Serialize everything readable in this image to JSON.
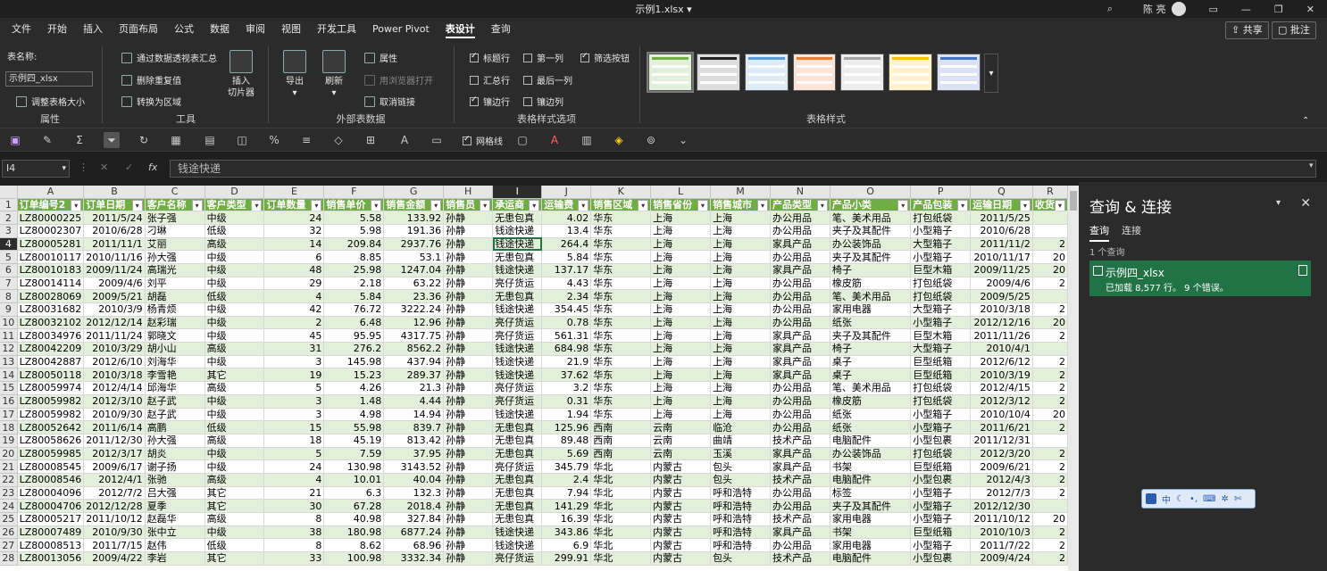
{
  "window": {
    "title": "示例1.xlsx",
    "user": "陈 亮"
  },
  "menu": {
    "tabs": [
      "文件",
      "开始",
      "插入",
      "页面布局",
      "公式",
      "数据",
      "审阅",
      "视图",
      "开发工具",
      "Power Pivot",
      "表设计",
      "查询"
    ],
    "active": "表设计",
    "share_label": "共享",
    "comment_label": "批注"
  },
  "ribbon": {
    "props": {
      "name_label": "表名称:",
      "name_value": "示例四_xlsx",
      "resize_label": "调整表格大小",
      "group": "属性"
    },
    "tools": {
      "pivot": "通过数据透视表汇总",
      "dedupe": "删除重复值",
      "convert": "转换为区域",
      "slicer": "插入\n切片器",
      "group": "工具"
    },
    "external": {
      "export": "导出",
      "refresh": "刷新",
      "properties": "属性",
      "open_browser": "用浏览器打开",
      "unlink": "取消链接",
      "group": "外部表数据"
    },
    "options": {
      "header_row": "标题行",
      "total_row": "汇总行",
      "banded_rows": "镶边行",
      "first_col": "第一列",
      "last_col": "最后一列",
      "banded_cols": "镶边列",
      "filter_btn": "筛选按钮",
      "group": "表格样式选项"
    },
    "styles": {
      "group": "表格样式"
    }
  },
  "qat": {
    "gridlines_label": "网格线"
  },
  "formula_bar": {
    "name_box": "I4",
    "fx": "fx",
    "content": "钱途快递"
  },
  "sheet": {
    "col_letters": [
      "A",
      "B",
      "C",
      "D",
      "E",
      "F",
      "G",
      "H",
      "I",
      "J",
      "K",
      "L",
      "M",
      "N",
      "O",
      "P",
      "Q",
      "R"
    ],
    "headers": [
      "订单编号2",
      "订单日期",
      "客户名称",
      "客户类型",
      "订单数量",
      "销售单价",
      "销售金额",
      "销售员",
      "承运商",
      "运输费",
      "销售区域",
      "销售省份",
      "销售城市",
      "产品类型",
      "产品小类",
      "产品包装",
      "运输日期",
      "收货"
    ],
    "rows": [
      [
        "LZ80000225",
        "2011/5/24",
        "张子强",
        "中级",
        "24",
        "5.58",
        "133.92",
        "孙静",
        "无患包真",
        "4.02",
        "华东",
        "上海",
        "上海",
        "办公用品",
        "笔、美术用品",
        "打包纸袋",
        "2011/5/25",
        ""
      ],
      [
        "LZ80002307",
        "2010/6/28",
        "刁琳",
        "低级",
        "32",
        "5.98",
        "191.36",
        "孙静",
        "钱途快递",
        "13.4",
        "华东",
        "上海",
        "上海",
        "办公用品",
        "夹子及其配件",
        "小型箱子",
        "2010/6/28",
        ""
      ],
      [
        "LZ80005281",
        "2011/11/1",
        "艾丽",
        "高级",
        "14",
        "209.84",
        "2937.76",
        "孙静",
        "钱途快递",
        "264.4",
        "华东",
        "上海",
        "上海",
        "家具产品",
        "办公装饰品",
        "大型箱子",
        "2011/11/2",
        "2"
      ],
      [
        "LZ80010117",
        "2010/11/16",
        "孙大强",
        "中级",
        "6",
        "8.85",
        "53.1",
        "孙静",
        "无患包真",
        "5.84",
        "华东",
        "上海",
        "上海",
        "办公用品",
        "夹子及其配件",
        "小型箱子",
        "2010/11/17",
        "20"
      ],
      [
        "LZ80010183",
        "2009/11/24",
        "高瑞光",
        "中级",
        "48",
        "25.98",
        "1247.04",
        "孙静",
        "钱途快递",
        "137.17",
        "华东",
        "上海",
        "上海",
        "家具产品",
        "椅子",
        "巨型木箱",
        "2009/11/25",
        "20"
      ],
      [
        "LZ80014114",
        "2009/4/6",
        "刘平",
        "中级",
        "29",
        "2.18",
        "63.22",
        "孙静",
        "亮仔货运",
        "4.43",
        "华东",
        "上海",
        "上海",
        "办公用品",
        "橡皮筋",
        "打包纸袋",
        "2009/4/6",
        "2"
      ],
      [
        "LZ80028069",
        "2009/5/21",
        "胡磊",
        "低级",
        "4",
        "5.84",
        "23.36",
        "孙静",
        "无患包真",
        "2.34",
        "华东",
        "上海",
        "上海",
        "办公用品",
        "笔、美术用品",
        "打包纸袋",
        "2009/5/25",
        ""
      ],
      [
        "LZ80031682",
        "2010/3/9",
        "杨青烦",
        "中级",
        "42",
        "76.72",
        "3222.24",
        "孙静",
        "钱途快递",
        "354.45",
        "华东",
        "上海",
        "上海",
        "办公用品",
        "家用电器",
        "大型箱子",
        "2010/3/18",
        "2"
      ],
      [
        "LZ80032102",
        "2012/12/14",
        "赵彩瑞",
        "中级",
        "2",
        "6.48",
        "12.96",
        "孙静",
        "亮仔货运",
        "0.78",
        "华东",
        "上海",
        "上海",
        "办公用品",
        "纸张",
        "小型箱子",
        "2012/12/16",
        "20"
      ],
      [
        "LZ80034976",
        "2011/11/24",
        "郭晓文",
        "中级",
        "45",
        "95.95",
        "4317.75",
        "孙静",
        "亮仔货运",
        "561.31",
        "华东",
        "上海",
        "上海",
        "家具产品",
        "夹子及其配件",
        "巨型木箱",
        "2011/11/26",
        "2"
      ],
      [
        "LZ80042209",
        "2010/3/29",
        "胡小山",
        "高级",
        "31",
        "276.2",
        "8562.2",
        "孙静",
        "钱途快递",
        "684.98",
        "华东",
        "上海",
        "上海",
        "家具产品",
        "椅子",
        "大型箱子",
        "2010/4/1",
        ""
      ],
      [
        "LZ80042887",
        "2012/6/10",
        "刘海华",
        "中级",
        "3",
        "145.98",
        "437.94",
        "孙静",
        "钱途快递",
        "21.9",
        "华东",
        "上海",
        "上海",
        "家具产品",
        "桌子",
        "巨型纸箱",
        "2012/6/12",
        "2"
      ],
      [
        "LZ80050118",
        "2010/3/18",
        "李雪艳",
        "其它",
        "19",
        "15.23",
        "289.37",
        "孙静",
        "钱途快递",
        "37.62",
        "华东",
        "上海",
        "上海",
        "家具产品",
        "桌子",
        "巨型纸箱",
        "2010/3/19",
        "2"
      ],
      [
        "LZ80059974",
        "2012/4/14",
        "邱海华",
        "高级",
        "5",
        "4.26",
        "21.3",
        "孙静",
        "亮仔货运",
        "3.2",
        "华东",
        "上海",
        "上海",
        "办公用品",
        "笔、美术用品",
        "打包纸袋",
        "2012/4/15",
        "2"
      ],
      [
        "LZ80059982",
        "2012/3/10",
        "赵子武",
        "中级",
        "3",
        "1.48",
        "4.44",
        "孙静",
        "亮仔货运",
        "0.31",
        "华东",
        "上海",
        "上海",
        "办公用品",
        "橡皮筋",
        "打包纸袋",
        "2012/3/12",
        "2"
      ],
      [
        "LZ80059982",
        "2010/9/30",
        "赵子武",
        "中级",
        "3",
        "4.98",
        "14.94",
        "孙静",
        "钱途快递",
        "1.94",
        "华东",
        "上海",
        "上海",
        "办公用品",
        "纸张",
        "小型箱子",
        "2010/10/4",
        "20"
      ],
      [
        "LZ80052642",
        "2011/6/14",
        "高鹏",
        "低级",
        "15",
        "55.98",
        "839.7",
        "孙静",
        "无患包真",
        "125.96",
        "西南",
        "云南",
        "临沧",
        "办公用品",
        "纸张",
        "小型箱子",
        "2011/6/21",
        "2"
      ],
      [
        "LZ80058626",
        "2011/12/30",
        "孙大强",
        "高级",
        "18",
        "45.19",
        "813.42",
        "孙静",
        "无患包真",
        "89.48",
        "西南",
        "云南",
        "曲靖",
        "技术产品",
        "电脑配件",
        "小型包裹",
        "2011/12/31",
        ""
      ],
      [
        "LZ80059985",
        "2012/3/17",
        "胡炎",
        "中级",
        "5",
        "7.59",
        "37.95",
        "孙静",
        "无患包真",
        "5.69",
        "西南",
        "云南",
        "玉溪",
        "家具产品",
        "办公装饰品",
        "打包纸袋",
        "2012/3/20",
        "2"
      ],
      [
        "LZ80008545",
        "2009/6/17",
        "谢子扬",
        "中级",
        "24",
        "130.98",
        "3143.52",
        "孙静",
        "亮仔货运",
        "345.79",
        "华北",
        "内蒙古",
        "包头",
        "家具产品",
        "书架",
        "巨型纸箱",
        "2009/6/21",
        "2"
      ],
      [
        "LZ80008546",
        "2012/4/1",
        "张驰",
        "高级",
        "4",
        "10.01",
        "40.04",
        "孙静",
        "无患包真",
        "2.4",
        "华北",
        "内蒙古",
        "包头",
        "技术产品",
        "电脑配件",
        "小型包裹",
        "2012/4/3",
        "2"
      ],
      [
        "LZ80004096",
        "2012/7/2",
        "吕大强",
        "其它",
        "21",
        "6.3",
        "132.3",
        "孙静",
        "无患包真",
        "7.94",
        "华北",
        "内蒙古",
        "呼和浩特",
        "办公用品",
        "标签",
        "小型箱子",
        "2012/7/3",
        "2"
      ],
      [
        "LZ80004706",
        "2012/12/28",
        "夏季",
        "其它",
        "30",
        "67.28",
        "2018.4",
        "孙静",
        "无患包真",
        "141.29",
        "华北",
        "内蒙古",
        "呼和浩特",
        "办公用品",
        "夹子及其配件",
        "小型箱子",
        "2012/12/30",
        ""
      ],
      [
        "LZ80005217",
        "2011/10/12",
        "赵磊华",
        "高级",
        "8",
        "40.98",
        "327.84",
        "孙静",
        "无患包真",
        "16.39",
        "华北",
        "内蒙古",
        "呼和浩特",
        "技术产品",
        "家用电器",
        "小型箱子",
        "2011/10/12",
        "20"
      ],
      [
        "LZ80007489",
        "2010/9/30",
        "张中立",
        "中级",
        "38",
        "180.98",
        "6877.24",
        "孙静",
        "钱途快递",
        "343.86",
        "华北",
        "内蒙古",
        "呼和浩特",
        "家具产品",
        "书架",
        "巨型纸箱",
        "2010/10/3",
        "2"
      ],
      [
        "LZ80008513",
        "2011/7/15",
        "赵伟",
        "低级",
        "8",
        "8.62",
        "68.96",
        "孙静",
        "钱途快递",
        "6.9",
        "华北",
        "内蒙古",
        "呼和浩特",
        "办公用品",
        "家用电器",
        "小型箱子",
        "2011/7/22",
        "2"
      ],
      [
        "LZ80013056",
        "2009/4/22",
        "李岩",
        "其它",
        "33",
        "100.98",
        "3332.34",
        "孙静",
        "亮仔货运",
        "299.91",
        "华北",
        "内蒙古",
        "包头",
        "技术产品",
        "电脑配件",
        "小型包裹",
        "2009/4/24",
        "2"
      ]
    ]
  },
  "pane": {
    "title": "查询 & 连接",
    "tabs": [
      "查询",
      "连接"
    ],
    "count": "1 个查询",
    "query_name": "示例四_xlsx",
    "query_status": "已加载 8,577 行。 9 个错误。"
  },
  "ime": {
    "lang": "中"
  }
}
